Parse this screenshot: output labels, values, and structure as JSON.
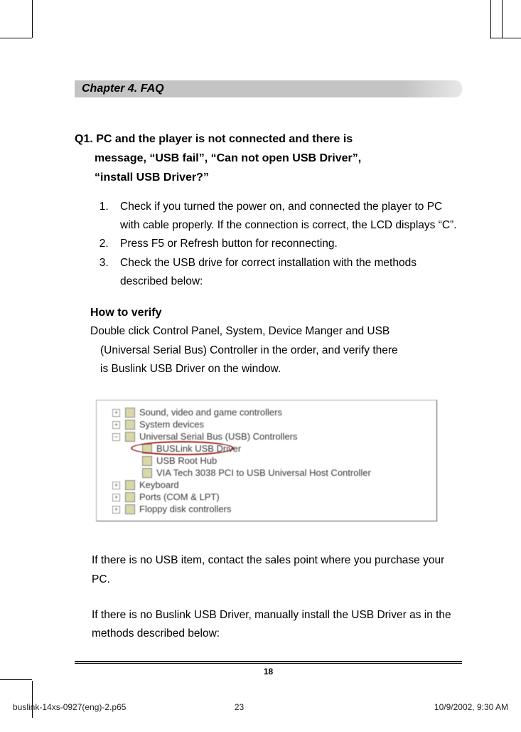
{
  "chapter_title": "Chapter 4. FAQ",
  "question": {
    "prefix": "Q1. ",
    "line1": "PC and the player is not connected and there is",
    "line2": "message, “USB fail”, “Can not open USB Driver”,",
    "line3": "“install USB Driver?”"
  },
  "steps": [
    "Check if you turned the power on, and connected the player to PC with cable properly. If the connection is correct, the LCD displays “C”.",
    "Press F5 or Refresh button for reconnecting.",
    "Check the USB drive for correct installation with the methods described below:"
  ],
  "verify": {
    "title": "How to verify",
    "line1": "Double click Control Panel, System, Device Manger and USB",
    "line2": "(Universal Serial Bus) Controller in the order, and verify there",
    "line3": "is Buslink USB Driver on the window."
  },
  "device_manager": {
    "items": [
      {
        "label": "Sound, video and game controllers",
        "expandable": true,
        "level": 0
      },
      {
        "label": "System devices",
        "expandable": true,
        "level": 0
      },
      {
        "label": "Universal Serial Bus (USB) Controllers",
        "expandable": true,
        "level": 0
      },
      {
        "label": "BUSLink USB Driver",
        "level": 1,
        "highlighted": true
      },
      {
        "label": "USB Root Hub",
        "level": 1
      },
      {
        "label": "VIA Tech 3038 PCI to USB Universal Host Controller",
        "level": 1
      },
      {
        "label": "Keyboard",
        "expandable": true,
        "level": 0
      },
      {
        "label": "Ports (COM & LPT)",
        "expandable": true,
        "level": 0
      },
      {
        "label": "Floppy disk controllers",
        "expandable": true,
        "level": 0
      }
    ]
  },
  "after_image": {
    "para1": "If there is no USB item, contact the sales point where you purchase your PC.",
    "para2": "If there is no Buslink USB Driver, manually install the USB Driver as in the methods described below:"
  },
  "page_number": "18",
  "footer": {
    "filename": "buslink-14xs-0927(eng)-2.p65",
    "page": "23",
    "datetime": "10/9/2002, 9:30 AM"
  }
}
